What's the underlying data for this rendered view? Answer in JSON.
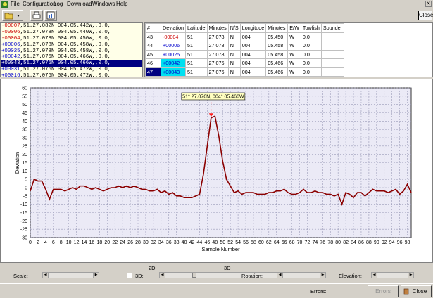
{
  "menu": [
    "File",
    "Configuration",
    "Log",
    "Download",
    "Windows",
    "Help"
  ],
  "top_close_label": "Close",
  "log_lines": [
    {
      "dev": "-00007",
      "text": ",51.27.082N 004.05.442W,,0.0,",
      "color": "#cc0000"
    },
    {
      "dev": "-00006",
      "text": ",51.27.078N 004.05.440W,,0.0,",
      "color": "#cc0000"
    },
    {
      "dev": "-00004",
      "text": ",51.27.078N 004.05.450W,,0.0,",
      "color": "#cc0000"
    },
    {
      "dev": "+00006",
      "text": ",51.27.078N 004.05.458W,,0.0,",
      "color": "#0000cc"
    },
    {
      "dev": "+00025",
      "text": ",51.27.078N 004.05.458W,,0.0,",
      "color": "#0000cc"
    },
    {
      "dev": "+00042",
      "text": ",51.27.076N 004.05.466W,,0.0,",
      "color": "#0000cc"
    },
    {
      "dev": "+00043",
      "text": ",51.27.076N 004.05.466W,,0.0,",
      "color": "#ffffff",
      "selected": true
    },
    {
      "dev": "+00031",
      "text": ",51.27.076N 004.05.472W,,0.0,",
      "color": "#0000cc"
    },
    {
      "dev": "+00016",
      "text": ",51.27.076N 004.05.472W,,0.0,",
      "color": "#0000cc"
    }
  ],
  "table": {
    "headers": [
      "#",
      "Deviation",
      "Latitude",
      "Minutes",
      "N/S",
      "Longitude",
      "Minutes",
      "E/W",
      "Towfish",
      "Sounder"
    ],
    "rows": [
      {
        "n": "43",
        "dev": "-00004",
        "lat": "51",
        "min": "27.078",
        "ns": "N",
        "lon": "004",
        "lmin": "05.450",
        "ew": "W",
        "tow": "0.0",
        "snd": "",
        "devcolor": "#cc0000"
      },
      {
        "n": "44",
        "dev": "+00006",
        "lat": "51",
        "min": "27.078",
        "ns": "N",
        "lon": "004",
        "lmin": "05.458",
        "ew": "W",
        "tow": "0.0",
        "snd": "",
        "devcolor": "#0000cc"
      },
      {
        "n": "45",
        "dev": "+00025",
        "lat": "51",
        "min": "27.078",
        "ns": "N",
        "lon": "004",
        "lmin": "05.458",
        "ew": "W",
        "tow": "0.0",
        "snd": "",
        "devcolor": "#0000cc"
      },
      {
        "n": "46",
        "dev": "+00042",
        "lat": "51",
        "min": "27.076",
        "ns": "N",
        "lon": "004",
        "lmin": "05.466",
        "ew": "W",
        "tow": "0.0",
        "snd": "",
        "devcolor": "#0000cc",
        "cyan": true
      },
      {
        "n": "47",
        "dev": "+00043",
        "lat": "51",
        "min": "27.076",
        "ns": "N",
        "lon": "004",
        "lmin": "05.466",
        "ew": "W",
        "tow": "0.0",
        "snd": "",
        "devcolor": "#0000cc",
        "cyan": true,
        "selected": true
      }
    ]
  },
  "chart_data": {
    "type": "line",
    "xlabel": "Sample Number",
    "ylabel": "Deviation",
    "xlim": [
      0,
      99
    ],
    "ylim": [
      -30,
      60
    ],
    "xticks": [
      0,
      2,
      4,
      6,
      8,
      10,
      12,
      14,
      16,
      18,
      20,
      22,
      24,
      26,
      28,
      30,
      32,
      34,
      36,
      38,
      40,
      42,
      44,
      46,
      48,
      50,
      52,
      54,
      56,
      58,
      60,
      62,
      64,
      66,
      68,
      70,
      72,
      74,
      76,
      78,
      80,
      82,
      84,
      86,
      88,
      90,
      92,
      94,
      96,
      98
    ],
    "yticks": [
      60,
      55,
      50,
      45,
      40,
      35,
      30,
      25,
      20,
      15,
      10,
      5,
      0,
      -5,
      -10,
      -15,
      -20,
      -25,
      -30
    ],
    "grid": true,
    "series": [
      {
        "color": "#8b0000",
        "values": [
          -2,
          5,
          4,
          4,
          -1,
          -7,
          -1,
          -1,
          -1,
          -2,
          -1,
          0,
          -1,
          1,
          1,
          0,
          -1,
          0,
          -1,
          -2,
          -1,
          0,
          0,
          1,
          0,
          1,
          0,
          1,
          0,
          -1,
          -1,
          -2,
          -2,
          -1,
          -3,
          -2,
          -4,
          -3,
          -5,
          -5,
          -6,
          -6,
          -6,
          -5,
          -4,
          8,
          25,
          42,
          43,
          31,
          16,
          5,
          1,
          -3,
          -2,
          -4,
          -3,
          -3,
          -3,
          -4,
          -4,
          -4,
          -3,
          -3,
          -2,
          -2,
          -1,
          -3,
          -4,
          -4,
          -3,
          -1,
          -3,
          -3,
          -2,
          -3,
          -3,
          -4,
          -4,
          -5,
          -4,
          -10,
          -3,
          -4,
          -6,
          -3,
          -3,
          -5,
          -3,
          -1,
          -2,
          -2,
          -2,
          -3,
          -2,
          -1,
          -4,
          -2,
          2,
          -3
        ]
      }
    ],
    "marker": {
      "x": 47,
      "y": 43,
      "label": "51° 27.076N, 004° 05.466W"
    }
  },
  "controls": {
    "scale_label": "Scale:",
    "label_2d": "2D",
    "label_3d_top": "3D",
    "checkbox_3d_label": "3D:",
    "rotation_label": "Rotation:",
    "elevation_label": "Elevation:"
  },
  "status": {
    "errors_label": "Errors:",
    "errors_button": "Errors",
    "close_button": "Close"
  }
}
